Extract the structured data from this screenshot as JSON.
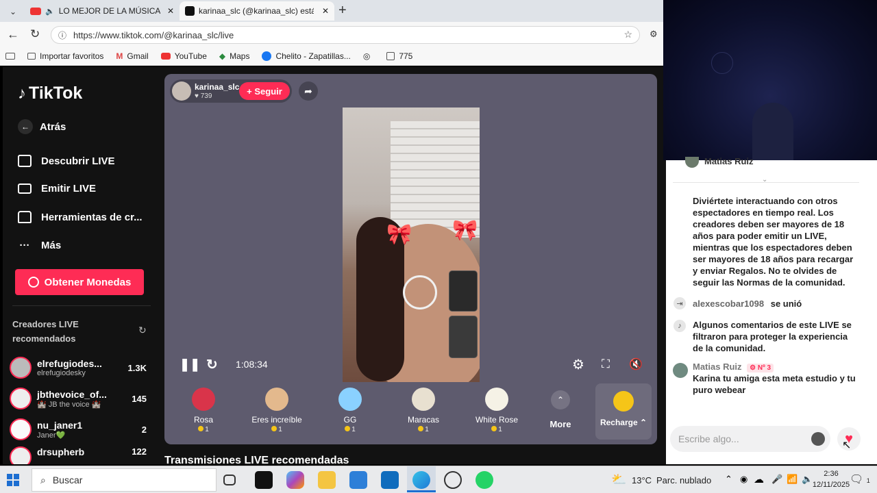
{
  "browser": {
    "tabs": [
      {
        "label": "LO MEJOR DE LA MÚSICA LA"
      },
      {
        "label": "karinaa_slc (@karinaa_slc) está LIV"
      }
    ],
    "url": "https://www.tiktok.com/@karinaa_slc/live",
    "favorites": [
      {
        "label": "Importar favoritos"
      },
      {
        "label": "Gmail"
      },
      {
        "label": "YouTube"
      },
      {
        "label": "Maps"
      },
      {
        "label": "Chelito - Zapatillas..."
      },
      {
        "label": ""
      },
      {
        "label": "775"
      }
    ]
  },
  "sidebar": {
    "logo": "TikTok",
    "back": "Atrás",
    "nav": [
      {
        "label": "Descubrir LIVE"
      },
      {
        "label": "Emitir LIVE"
      },
      {
        "label": "Herramientas de cr..."
      },
      {
        "label": "Más"
      }
    ],
    "coins_button": "Obtener Monedas",
    "recommended_title": "Creadores LIVE recomendados",
    "creators": [
      {
        "name": "elrefugiodes...",
        "sub": "elrefugiodesky",
        "count": "1.3K"
      },
      {
        "name": "jbthevoice_of...",
        "sub": "🏰 JB the voice 🏰",
        "count": "145"
      },
      {
        "name": "nu_janer1",
        "sub": "Janer💚",
        "count": "2"
      },
      {
        "name": "drsupherb",
        "sub": "",
        "count": "122"
      }
    ]
  },
  "stream": {
    "host": "karinaa_slc",
    "likes": "739",
    "follow": "+ Seguir",
    "time": "1:08:34",
    "gifts": [
      {
        "name": "Rosa",
        "price": "1",
        "color": "#d9344a"
      },
      {
        "name": "Eres increíble",
        "price": "1",
        "color": "#e3b98d"
      },
      {
        "name": "GG",
        "price": "1",
        "color": "#8ad1ff"
      },
      {
        "name": "Maracas",
        "price": "1",
        "color": "#e8e0d0"
      },
      {
        "name": "White Rose",
        "price": "1",
        "color": "#f5f2e6"
      }
    ],
    "more": "More",
    "recharge": "Recharge",
    "recommended_streams": "Transmisiones LIVE recomendadas"
  },
  "chat": {
    "top_user": "Matias Ruiz",
    "intro": "Diviértete interactuando con otros espectadores en tiempo real. Los creadores deben ser mayores de 18 años para poder emitir un LIVE, mientras que los espectadores deben ser mayores de 18 años para recargar y enviar Regalos. No te olvides de seguir las Normas de la comunidad.",
    "joined_user": "alexescobar1098",
    "joined_text": "se unió",
    "filter_note": "Algunos comentarios de este LIVE se filtraron para proteger la experiencia de la comunidad.",
    "comment_user": "Matias Ruiz",
    "comment_badge": "Nº 3",
    "comment_text": "Karina tu amiga esta meta estudio y tu puro webear",
    "input_placeholder": "Escribe algo..."
  },
  "taskbar": {
    "search": "Buscar",
    "weather": "13°C",
    "weather_desc": "Parc. nublado",
    "time": "2:36",
    "date": "12/11/2025",
    "notif_count": "1"
  },
  "colors": {
    "accent": "#fe2c55",
    "player": "#5e5b6e"
  }
}
